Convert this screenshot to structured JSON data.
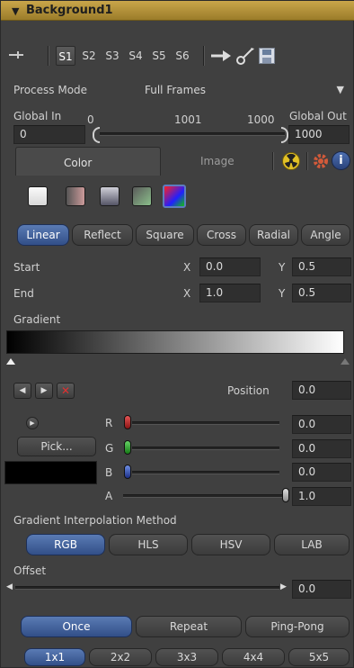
{
  "header": {
    "title": "Background1"
  },
  "toolbar": {
    "slots": [
      "S1",
      "S2",
      "S3",
      "S4",
      "S5",
      "S6"
    ],
    "active_slot": "S1"
  },
  "process_mode": {
    "label": "Process Mode",
    "value": "Full Frames"
  },
  "global": {
    "in_label": "Global In",
    "out_label": "Global Out",
    "in_value": "0",
    "out_value": "1000",
    "range_start": "0",
    "range_mid": "1001",
    "range_end": "1000"
  },
  "tabs": {
    "color": "Color",
    "image": "Image"
  },
  "gradient_types": [
    "Linear",
    "Reflect",
    "Square",
    "Cross",
    "Radial",
    "Angle"
  ],
  "start": {
    "label": "Start",
    "x_label": "X",
    "x": "0.0",
    "y_label": "Y",
    "y": "0.5"
  },
  "end": {
    "label": "End",
    "x_label": "X",
    "x": "1.0",
    "y_label": "Y",
    "y": "0.5"
  },
  "gradient": {
    "label": "Gradient",
    "position_label": "Position",
    "position": "0.0"
  },
  "channels": {
    "pick_label": "Pick...",
    "r_label": "R",
    "r_value": "0.0",
    "r_level": 0,
    "g_label": "G",
    "g_value": "0.0",
    "g_level": 0,
    "b_label": "B",
    "b_value": "0.0",
    "b_level": 0,
    "a_label": "A",
    "a_value": "1.0",
    "a_level": 1,
    "swatch_color": "#000000"
  },
  "interp": {
    "label": "Gradient Interpolation Method",
    "options": [
      "RGB",
      "HLS",
      "HSV",
      "LAB"
    ]
  },
  "offset": {
    "label": "Offset",
    "value": "0.0"
  },
  "repeat": [
    "Once",
    "Repeat",
    "Ping-Pong"
  ],
  "subpixel": [
    "1x1",
    "2x2",
    "3x3",
    "4x4",
    "5x5"
  ],
  "colors": {
    "accent": "#3d5e9c",
    "header": "#b8953c"
  }
}
